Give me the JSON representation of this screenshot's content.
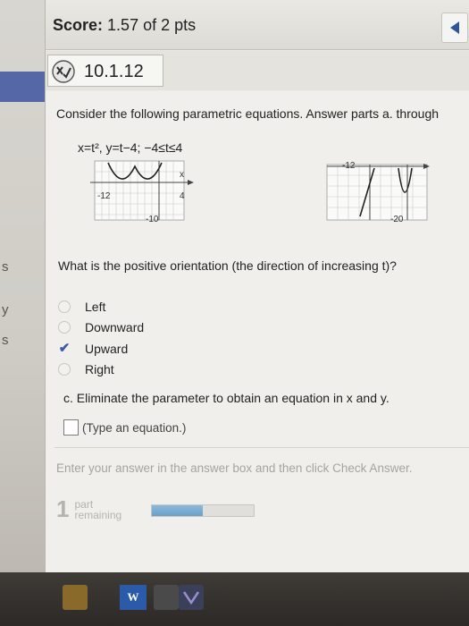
{
  "header": {
    "score_label": "Score:",
    "score_value": "1.57 of 2 pts"
  },
  "question": {
    "id": "10.1.12",
    "prompt": "Consider the following parametric equations. Answer parts a. through",
    "equation": "x=t², y=t−4;  −4≤t≤4",
    "sub_question": "What is the positive orientation (the direction of increasing t)?",
    "options": [
      {
        "label": "Left",
        "selected": false
      },
      {
        "label": "Downward",
        "selected": false
      },
      {
        "label": "Upward",
        "selected": true
      },
      {
        "label": "Right",
        "selected": false
      }
    ],
    "part_c": "c. Eliminate the parameter to obtain an equation in x and y.",
    "answer_hint": "(Type an equation.)",
    "instructions": "Enter your answer in the answer box and then click Check Answer.",
    "parts_remaining_count": "1",
    "parts_remaining_label_1": "part",
    "parts_remaining_label_2": "remaining",
    "progress_fraction": 0.5
  },
  "graph_left": {
    "x_label": "x",
    "tick_neg": "-12",
    "tick_pos": "4",
    "tick_y": "-10"
  },
  "graph_right": {
    "tick_top": "-12",
    "tick_bottom": "-20"
  },
  "left_strip_fragments": [
    "s",
    "y",
    "s"
  ],
  "taskbar": {
    "word_icon_label": "W"
  },
  "colors": {
    "accent": "#3c5aa8",
    "progress": "#7aabd2",
    "sidebar_blue": "#5567a6"
  }
}
